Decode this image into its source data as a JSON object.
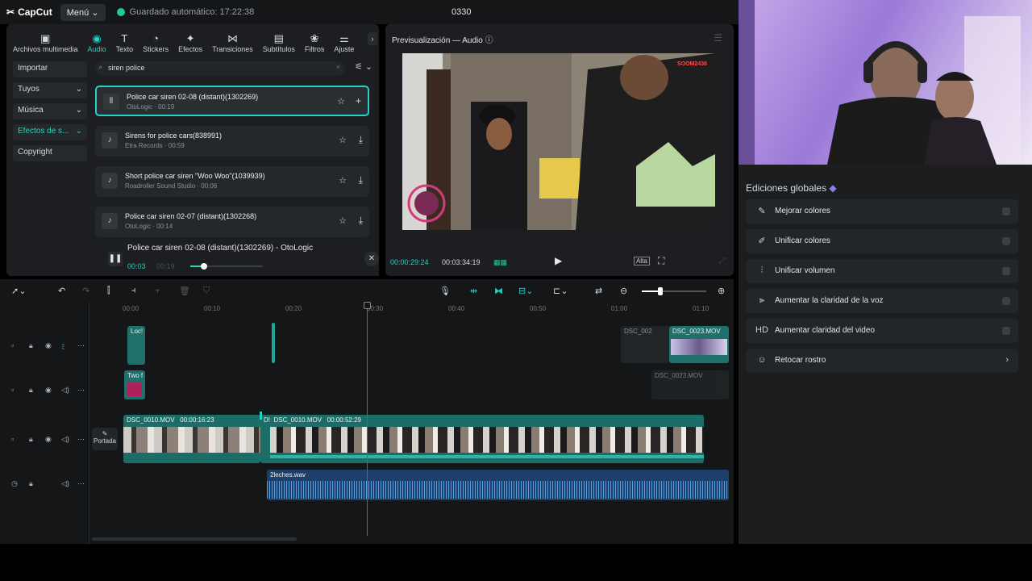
{
  "topbar": {
    "logo": "CapCut",
    "menu_label": "Menú",
    "autosave": "Guardado automático: 17:22:38",
    "project_title": "0330"
  },
  "media_tabs": [
    {
      "label": "Archivos multimedia",
      "icon": "media-icon",
      "glyph": "▣",
      "active": false
    },
    {
      "label": "Audio",
      "icon": "audio-icon",
      "glyph": "◉",
      "active": true
    },
    {
      "label": "Texto",
      "icon": "text-icon",
      "glyph": "T",
      "active": false
    },
    {
      "label": "Stickers",
      "icon": "sticker-icon",
      "glyph": "◔",
      "active": false
    },
    {
      "label": "Efectos",
      "icon": "effects-icon",
      "glyph": "✦",
      "active": false
    },
    {
      "label": "Transiciones",
      "icon": "transition-icon",
      "glyph": "⋈",
      "active": false
    },
    {
      "label": "Subtítulos",
      "icon": "subtitle-icon",
      "glyph": "▤",
      "active": false
    },
    {
      "label": "Filtros",
      "icon": "filter-icon",
      "glyph": "❀",
      "active": false
    },
    {
      "label": "Ajuste",
      "icon": "adjust-icon",
      "glyph": "⚌",
      "active": false
    }
  ],
  "categories": [
    {
      "label": "Importar",
      "chev": "",
      "active": false
    },
    {
      "label": "Tuyos",
      "chev": "⌄",
      "active": false
    },
    {
      "label": "Música",
      "chev": "⌄",
      "active": false
    },
    {
      "label": "Efectos de s...",
      "chev": "⌄",
      "active": true
    },
    {
      "label": "Copyright",
      "chev": "",
      "active": false
    }
  ],
  "search": {
    "value": "siren police"
  },
  "tracks": [
    {
      "title": "Police car siren 02-08 (distant)(1302269)",
      "sub": "OtoLogic · 00:19",
      "action": "+",
      "selected": true
    },
    {
      "title": "Sirens for police cars(838991)",
      "sub": "Etra Records · 00:59",
      "action": "⤓",
      "selected": false
    },
    {
      "title": "Short police car siren \"Woo Woo\"(1039939)",
      "sub": "Roadroller Sound Studio · 00:06",
      "action": "⤓",
      "selected": false
    },
    {
      "title": "Police car siren 02-07 (distant)(1302268)",
      "sub": "OtoLogic · 00:14",
      "action": "⤓",
      "selected": false
    }
  ],
  "player": {
    "title": "Police car siren 02-08 (distant)(1302269) - OtoLogic",
    "current": "00:03",
    "duration": "00:19",
    "progress": 0.16
  },
  "preview": {
    "title": "Previsualización — Audio",
    "time_current": "00:00:29:24",
    "time_total": "00:03:34:19",
    "ratio": "Alta",
    "overlay_score": "SOOM2436"
  },
  "global_edits": {
    "title": "Ediciones globales",
    "items": [
      {
        "label": "Mejorar colores",
        "icon": "enhance-colors-icon",
        "glyph": "✎",
        "control": "toggle"
      },
      {
        "label": "Unificar colores",
        "icon": "unify-colors-icon",
        "glyph": "✐",
        "control": "toggle"
      },
      {
        "label": "Unificar volumen",
        "icon": "volume-icon",
        "glyph": "⫶",
        "control": "toggle"
      },
      {
        "label": "Aumentar la claridad de la voz",
        "icon": "voice-icon",
        "glyph": "⫸",
        "control": "toggle"
      },
      {
        "label": "Aumentar claridad del video",
        "icon": "hd-icon",
        "glyph": "HD",
        "control": "toggle"
      },
      {
        "label": "Retocar rostro",
        "icon": "face-icon",
        "glyph": "☺",
        "control": "chevron"
      }
    ]
  },
  "timeline": {
    "ruler": [
      "00:00",
      "00:10",
      "00:20",
      "00:30",
      "00:40",
      "00:50",
      "01:00",
      "01:10"
    ],
    "cover_label": "Portada",
    "clips": {
      "text1": "Loc!",
      "text2": "Two f",
      "overlay1": "DSC_002",
      "overlay2": "DSC_0023.MOV",
      "overlay3": "DSC_0023.MOV",
      "main1_name": "DSC_0010.MOV",
      "main1_dur": "00:00:16:23",
      "main2_prefix": "D!",
      "main2_name": "DSC_0010.MOV",
      "main2_dur": "00:00:52:29",
      "audio": "2leches.wav"
    }
  }
}
